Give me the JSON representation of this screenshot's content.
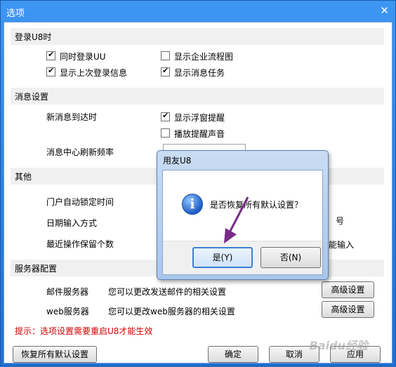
{
  "window": {
    "title": "选项",
    "close_glyph": "✕"
  },
  "sections": {
    "login": "登录U8时",
    "message": "消息设置",
    "other": "其他",
    "server": "服务器配置"
  },
  "login": {
    "simul_login": "同时登录UU",
    "show_last_login": "显示上次登录信息",
    "show_flowchart": "显示企业流程图",
    "show_msg_tasks": "显示消息任务"
  },
  "message": {
    "arrive_label": "新消息到达时",
    "popup_remind": "显示浮窗提醒",
    "play_sound": "播放提醒声音",
    "refresh_label": "消息中心刷新频率"
  },
  "other": {
    "auto_lock": "门户自动锁定时间",
    "date_input": "日期输入方式",
    "recent_ops": "最近操作保留个数",
    "peek_right_1": "号",
    "peek_right_2": "能输入"
  },
  "server": {
    "mail_label": "邮件服务器",
    "mail_desc": "您可以更改发送邮件的相关设置",
    "web_label": "web服务器",
    "web_desc": "您可以更改web服务器的相关设置",
    "advanced": "高级设置"
  },
  "hint": "提示：选项设置需要重启U8才能生效",
  "footer": {
    "restore": "恢复所有默认设置",
    "ok": "确定",
    "cancel": "取消",
    "apply": "应用"
  },
  "dialog": {
    "title": "用友U8",
    "message": "是否恢复所有默认设置？",
    "yes": "是(Y)",
    "no": "否(N)",
    "icon_glyph": "i"
  },
  "watermark": "Baidu经验",
  "colors": {
    "titlebar": "#2f86e6",
    "hint": "#d00000",
    "arrow": "#7a2a8a"
  }
}
